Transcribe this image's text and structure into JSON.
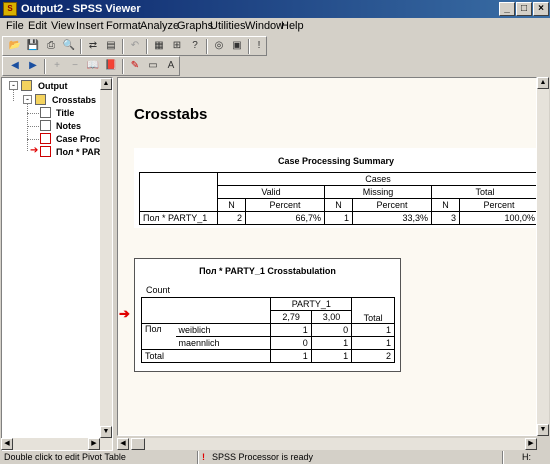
{
  "window": {
    "title": "Output2 - SPSS Viewer"
  },
  "menu": [
    "File",
    "Edit",
    "View",
    "Insert",
    "Format",
    "Analyze",
    "Graphs",
    "Utilities",
    "Window",
    "Help"
  ],
  "tree": {
    "output": "Output",
    "crosstabs": "Crosstabs",
    "title": "Title",
    "notes": "Notes",
    "case_processing": "Case Proce",
    "selected": "Пол * PAR"
  },
  "main": {
    "heading": "Crosstabs",
    "case_summary": {
      "title": "Case Processing Summary",
      "cases_label": "Cases",
      "groups": [
        "Valid",
        "Missing",
        "Total"
      ],
      "subheaders": [
        "N",
        "Percent",
        "N",
        "Percent",
        "N",
        "Percent"
      ],
      "row_label": "Пол * PARTY_1",
      "row_values": [
        "2",
        "66,7%",
        "1",
        "33,3%",
        "3",
        "100,0%"
      ]
    },
    "crosstab": {
      "title": "Пол * PARTY_1 Crosstabulation",
      "count_label": "Count",
      "col_var": "PARTY_1",
      "col_values": [
        "2,79",
        "3,00"
      ],
      "total_label": "Total",
      "row_var": "Пол",
      "rows": [
        {
          "label": "weiblich",
          "values": [
            "1",
            "0",
            "1"
          ]
        },
        {
          "label": "maennlich",
          "values": [
            "0",
            "1",
            "1"
          ]
        }
      ],
      "total_row": {
        "label": "Total",
        "values": [
          "1",
          "1",
          "2"
        ]
      }
    }
  },
  "status": {
    "hint": "Double click to edit Pivot Table",
    "processor": "SPSS Processor  is ready",
    "right": "H:"
  },
  "colors": {
    "titlebar": "#0a246a",
    "pane_bg": "#fcf9f2",
    "arrow": "#e00000"
  }
}
